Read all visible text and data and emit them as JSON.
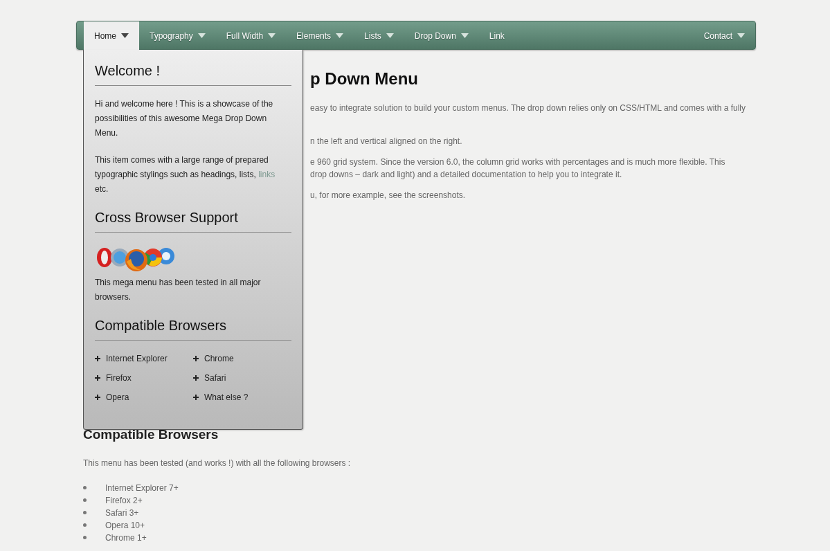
{
  "nav": {
    "items": [
      {
        "label": "Home",
        "selected": true,
        "caret": true
      },
      {
        "label": "Typography",
        "selected": false,
        "caret": true
      },
      {
        "label": "Full Width",
        "selected": false,
        "caret": true
      },
      {
        "label": "Elements",
        "selected": false,
        "caret": true
      },
      {
        "label": "Lists",
        "selected": false,
        "caret": true
      },
      {
        "label": "Drop Down",
        "selected": false,
        "caret": true
      },
      {
        "label": "Link",
        "selected": false,
        "caret": false
      }
    ],
    "right_items": [
      {
        "label": "Contact",
        "selected": false,
        "caret": true
      }
    ]
  },
  "dropdown": {
    "sections": [
      {
        "kind": "text",
        "heading": "Welcome !",
        "paragraphs": [
          {
            "text": "Hi and welcome here ! This is a showcase of the possibilities of this awesome Mega Drop Down Menu."
          },
          {
            "text": "This item comes with a large range of prepared typographic stylings such as headings, lists, ",
            "link": "links",
            "after": " etc."
          }
        ]
      },
      {
        "kind": "logos",
        "heading": "Cross Browser Support",
        "paragraphs": [
          {
            "text": "This mega menu has been tested in all major browsers."
          }
        ]
      },
      {
        "kind": "columns",
        "heading": "Compatible Browsers",
        "columns": [
          [
            "Internet Explorer",
            "Firefox",
            "Opera"
          ],
          [
            "Chrome",
            "Safari",
            "What else ?"
          ]
        ]
      }
    ]
  },
  "content": {
    "title": "p Down Menu",
    "lines": [
      "easy to integrate solution to build your custom menus. The drop down relies only on CSS/HTML and comes with a fully",
      "n the left and vertical aligned on the right.",
      "e 960 grid system. Since the version 6.0, the column grid works with percentages and is much more flexible. This",
      "drop downs – dark and light) and a detailed documentation to help you to integrate it.",
      "u, for more example, see the screenshots."
    ],
    "section_heading": "Compatible Browsers",
    "intro": "This menu has been tested (and works !) with all the following browsers :",
    "list": [
      "Internet Explorer 7+",
      "Firefox 2+",
      "Safari 3+",
      "Opera 10+",
      "Chrome 1+"
    ]
  }
}
